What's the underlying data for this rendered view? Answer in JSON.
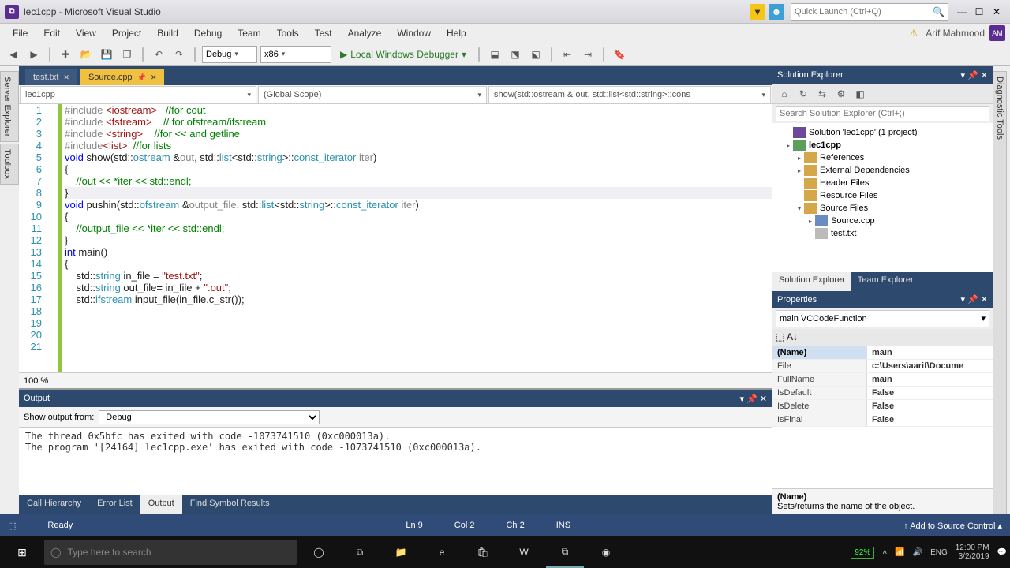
{
  "title": "lec1cpp - Microsoft Visual Studio",
  "quicklaunch_placeholder": "Quick Launch (Ctrl+Q)",
  "user": "Arif Mahmood",
  "user_initials": "AM",
  "menus": [
    "File",
    "Edit",
    "View",
    "Project",
    "Build",
    "Debug",
    "Team",
    "Tools",
    "Test",
    "Analyze",
    "Window",
    "Help"
  ],
  "toolbar": {
    "config": "Debug",
    "platform": "x86",
    "run": "Local Windows Debugger"
  },
  "side_left": [
    "Server Explorer",
    "Toolbox"
  ],
  "side_right": "Diagnostic Tools",
  "editor": {
    "tabs": [
      {
        "label": "test.txt",
        "active": false
      },
      {
        "label": "Source.cpp",
        "active": true,
        "pinned": true
      }
    ],
    "scope1": "lec1cpp",
    "scope2": "(Global Scope)",
    "scope3": "show(std::ostream & out, std::list<std::string>::cons",
    "zoom": "100 %",
    "lines": [
      {
        "n": 1,
        "html": "<span class='tok-pp'>#include</span> <span class='tok-inc'>&lt;iostream&gt;</span>   <span class='tok-cm'>//for cout</span>"
      },
      {
        "n": 2,
        "html": "<span class='tok-pp'>#include</span> <span class='tok-inc'>&lt;fstream&gt;</span>    <span class='tok-cm'>// for ofstream/ifstream</span>"
      },
      {
        "n": 3,
        "html": "<span class='tok-pp'>#include</span> <span class='tok-inc'>&lt;string&gt;</span>    <span class='tok-cm'>//for &lt;&lt; and getline</span>"
      },
      {
        "n": 4,
        "html": "<span class='tok-pp'>#include</span><span class='tok-inc'>&lt;list&gt;</span>  <span class='tok-cm'>//for lists</span>"
      },
      {
        "n": 5,
        "html": ""
      },
      {
        "n": 6,
        "html": "<span class='tok-kw'>void</span> show(std::<span class='tok-ty'>ostream</span> &amp;<span style='color:#888'>out</span>, std::<span class='tok-ty'>list</span>&lt;std::<span class='tok-ty'>string</span>&gt;::<span class='tok-ty'>const_iterator</span> <span style='color:#888'>iter</span>)"
      },
      {
        "n": 7,
        "html": "{"
      },
      {
        "n": 8,
        "html": "    <span class='tok-cm'>//out &lt;&lt; *iter &lt;&lt; std::endl;</span>"
      },
      {
        "n": 9,
        "html": "}"
      },
      {
        "n": 10,
        "html": ""
      },
      {
        "n": 11,
        "html": "<span class='tok-kw'>void</span> pushin(std::<span class='tok-ty'>ofstream</span> &amp;<span style='color:#888'>output_file</span>, std::<span class='tok-ty'>list</span>&lt;std::<span class='tok-ty'>string</span>&gt;::<span class='tok-ty'>const_iterator</span> <span style='color:#888'>iter</span>)"
      },
      {
        "n": 12,
        "html": "{"
      },
      {
        "n": 13,
        "html": "    <span class='tok-cm'>//output_file &lt;&lt; *iter &lt;&lt; std::endl;</span>"
      },
      {
        "n": 14,
        "html": "}"
      },
      {
        "n": 15,
        "html": ""
      },
      {
        "n": 16,
        "html": "<span class='tok-kw'>int</span> main()"
      },
      {
        "n": 17,
        "html": "{"
      },
      {
        "n": 18,
        "html": "    std::<span class='tok-ty'>string</span> in_file = <span class='tok-str'>\"test.txt\"</span>;"
      },
      {
        "n": 19,
        "html": "    std::<span class='tok-ty'>string</span> out_file= in_file + <span class='tok-str'>\".out\"</span>;"
      },
      {
        "n": 20,
        "html": ""
      },
      {
        "n": 21,
        "html": "    std::<span class='tok-ty'>ifstream</span> input_file(in_file.c_str());"
      }
    ]
  },
  "output": {
    "title": "Output",
    "from_label": "Show output from:",
    "from_value": "Debug",
    "text": "The thread 0x5bfc has exited with code -1073741510 (0xc000013a).\nThe program '[24164] lec1cpp.exe' has exited with code -1073741510 (0xc000013a).",
    "tabs": [
      "Call Hierarchy",
      "Error List",
      "Output",
      "Find Symbol Results"
    ],
    "active_tab": "Output"
  },
  "solution_explorer": {
    "title": "Solution Explorer",
    "search_placeholder": "Search Solution Explorer (Ctrl+;)",
    "nodes": [
      {
        "lvl": 1,
        "icon": "sln",
        "text": "Solution 'lec1cpp' (1 project)",
        "tw": ""
      },
      {
        "lvl": 1,
        "icon": "prj",
        "text": "lec1cpp",
        "tw": "▸",
        "bold": true
      },
      {
        "lvl": 2,
        "icon": "fld",
        "text": "References",
        "tw": "▸"
      },
      {
        "lvl": 2,
        "icon": "fld",
        "text": "External Dependencies",
        "tw": "▸"
      },
      {
        "lvl": 2,
        "icon": "fld",
        "text": "Header Files",
        "tw": ""
      },
      {
        "lvl": 2,
        "icon": "fld",
        "text": "Resource Files",
        "tw": ""
      },
      {
        "lvl": 2,
        "icon": "fld",
        "text": "Source Files",
        "tw": "▾"
      },
      {
        "lvl": 3,
        "icon": "cpp",
        "text": "Source.cpp",
        "tw": "▸"
      },
      {
        "lvl": 3,
        "icon": "txt",
        "text": "test.txt",
        "tw": ""
      }
    ],
    "tabs": [
      "Solution Explorer",
      "Team Explorer"
    ]
  },
  "properties": {
    "title": "Properties",
    "selector": "main VCCodeFunction",
    "rows": [
      {
        "k": "(Name)",
        "v": "main",
        "hi": true
      },
      {
        "k": "File",
        "v": "c:\\Users\\aarif\\Docume"
      },
      {
        "k": "FullName",
        "v": "main"
      },
      {
        "k": "IsDefault",
        "v": "False"
      },
      {
        "k": "IsDelete",
        "v": "False"
      },
      {
        "k": "IsFinal",
        "v": "False"
      }
    ],
    "desc_title": "(Name)",
    "desc_text": "Sets/returns the name of the object."
  },
  "status": {
    "msg": "Ready",
    "ln": "Ln 9",
    "col": "Col 2",
    "ch": "Ch 2",
    "ins": "INS",
    "src": "Add to Source Control"
  },
  "taskbar": {
    "search": "Type here to search",
    "battery": "92%",
    "lang": "ENG",
    "time": "12:00 PM",
    "date": "3/2/2019"
  }
}
